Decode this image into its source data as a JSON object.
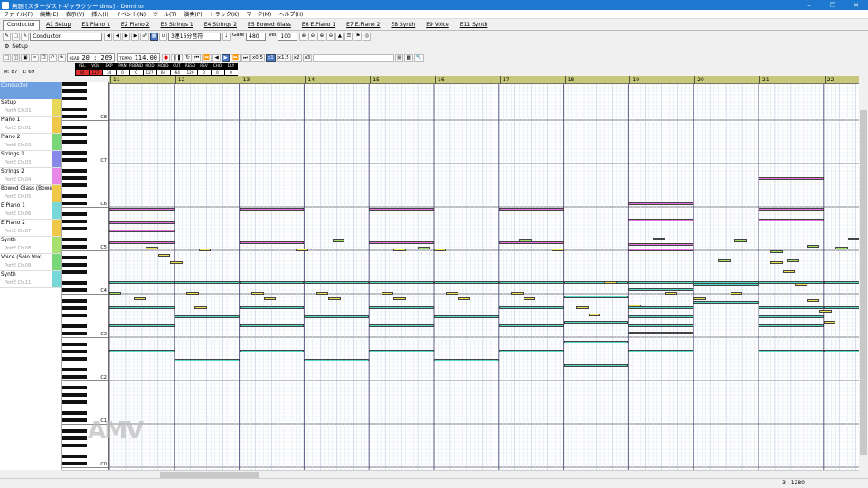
{
  "window": {
    "title": "無題 [スターダストギャラクシー.dms] - Domino"
  },
  "menu": [
    "ファイル(F)",
    "編集(E)",
    "表示(V)",
    "挿入(I)",
    "イベント(N)",
    "ツール(T)",
    "演奏(P)",
    "トラック(K)",
    "マーク(M)",
    "ヘルプ(H)"
  ],
  "tabs": [
    "Conductor",
    "A1 Setup",
    "E1 Piano 1",
    "E2 Piano 2",
    "E3 Strings 1",
    "E4 Strings 2",
    "E5 Bowed Glass",
    "E6 E.Piano 1",
    "E7 E.Piano 2",
    "E8 Synth",
    "E9 Voice",
    "E11 Synth"
  ],
  "toolbar1": {
    "track_select": "Conductor",
    "quantize": "3連16分音符",
    "gate_label": "Gate",
    "gate_value": "480",
    "vel_label": "Vel",
    "vel_value": "100"
  },
  "toolbar2": {
    "head_label": "HEAD",
    "time": "20 : 269",
    "tempo_label": "TEMPO",
    "tempo": "114.00",
    "speeds": [
      "x0.5",
      "x1",
      "x1.5",
      "x2",
      "x3"
    ]
  },
  "levels": {
    "labels": [
      "VEL",
      "VOL",
      "EXP",
      "PAN",
      "P.BEND",
      "MOD",
      "HOLD",
      "CUT",
      "RESO",
      "REV",
      "CHO",
      "DLY"
    ],
    "values": [
      "90",
      "127",
      "34",
      "0",
      "0",
      "127",
      "64",
      "-64",
      "120",
      "0",
      "0",
      "0"
    ]
  },
  "mini": {
    "measure": "87",
    "beat": "69"
  },
  "setup_label": "Setup",
  "tracks": [
    {
      "name": "Conductor",
      "port": "",
      "color": ""
    },
    {
      "name": "Setup",
      "port": "PortA  Ch.01",
      "color": "#e8d85a"
    },
    {
      "name": "Piano 1",
      "port": "PortE  Ch.01",
      "color": "#f0c848"
    },
    {
      "name": "Piano 2",
      "port": "PortE  Ch.02",
      "color": "#78d878"
    },
    {
      "name": "Strings 1",
      "port": "PortE  Ch.03",
      "color": "#8888e8"
    },
    {
      "name": "Strings 2",
      "port": "PortE  Ch.04",
      "color": "#e888e8"
    },
    {
      "name": "Bowed Glass (Bowed",
      "port": "PortE  Ch.05",
      "color": "#f0c848"
    },
    {
      "name": "E.Piano 1",
      "port": "PortE  Ch.06",
      "color": "#78d8d8"
    },
    {
      "name": "E.Piano 2",
      "port": "PortE  Ch.07",
      "color": "#f0c848"
    },
    {
      "name": "Synth",
      "port": "PortE  Ch.08",
      "color": "#a8e070"
    },
    {
      "name": "Voice (Solo Vox)",
      "port": "PortE  Ch.09",
      "color": "#78d878"
    },
    {
      "name": "Synth",
      "port": "PortE  Ch.11",
      "color": "#78d8d8"
    }
  ],
  "octave_labels": [
    "C8",
    "C7",
    "C6",
    "C5",
    "C4",
    "C3",
    "C2",
    "C1",
    "C0"
  ],
  "bars": [
    "11",
    "12",
    "13",
    "14",
    "15",
    "16",
    "17",
    "18",
    "19",
    "20",
    "21",
    "22"
  ],
  "note_colors": {
    "pink": "#e070e0",
    "teal": "#50d8c8",
    "yellow": "#f0e050",
    "green": "#a0e060"
  },
  "status": {
    "position": "3 : 1280"
  },
  "logo_text": "AMV"
}
